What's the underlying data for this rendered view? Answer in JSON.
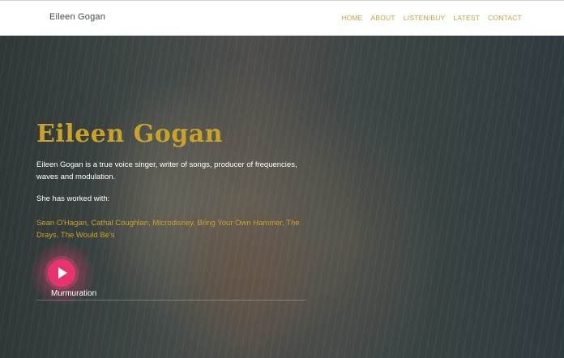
{
  "site": {
    "logo": "Eileen Gogan"
  },
  "nav": {
    "items": [
      {
        "label": "HOME"
      },
      {
        "label": "ABOUT"
      },
      {
        "label": "LISTEN/BUY"
      },
      {
        "label": "LATEST"
      },
      {
        "label": "CONTACT"
      }
    ]
  },
  "hero": {
    "title": "Eileen Gogan",
    "bio": "Eileen Gogan is a true voice singer, writer of songs, producer of frequencies, waves and modulation.",
    "worked_with_label": "She has worked with:",
    "collaborators": [
      "Sean O'Hagan",
      "Cathal Coughlan",
      "Microdisney",
      "Bring Your Own Hammer",
      "The Drays",
      "The Would Be's"
    ]
  },
  "player": {
    "track_title": "Murmuration"
  },
  "colors": {
    "accent_gold": "#c9a227",
    "play_pink": "#e8336f"
  }
}
